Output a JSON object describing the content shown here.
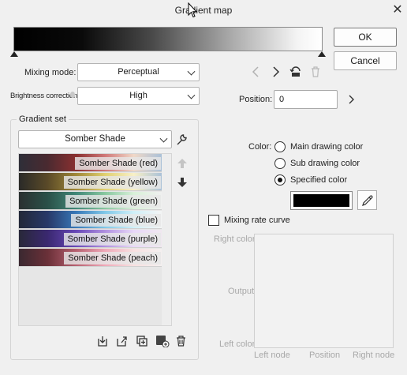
{
  "window": {
    "title": "Gradient map"
  },
  "buttons": {
    "ok": "OK",
    "cancel": "Cancel"
  },
  "mixing_mode": {
    "label": "Mixing mode:",
    "value": "Perceptual"
  },
  "brightness_correction": {
    "label": "Brightness correction",
    "value": "High"
  },
  "gradient_set": {
    "title": "Gradient set",
    "selected": "Somber Shade",
    "items": [
      {
        "label": "Somber Shade (red)",
        "colors": [
          "#2e2e38",
          "#4a2a30",
          "#8a3030",
          "#d07878",
          "#f0d8c8",
          "#a8c0d8"
        ]
      },
      {
        "label": "Somber Shade (yellow)",
        "colors": [
          "#2a2a28",
          "#5a4a28",
          "#a08838",
          "#e0d070",
          "#f8f0c8",
          "#a8c0d8"
        ]
      },
      {
        "label": "Somber Shade (green)",
        "colors": [
          "#2a3030",
          "#2a5048",
          "#408878",
          "#88c8a0",
          "#d8f0d8",
          "#f0f0f0"
        ]
      },
      {
        "label": "Somber Shade (blue)",
        "colors": [
          "#222838",
          "#283868",
          "#3878b8",
          "#80c8e8",
          "#d0f0f8",
          "#f4f4f4"
        ]
      },
      {
        "label": "Somber Shade (purple)",
        "colors": [
          "#282838",
          "#3a2870",
          "#6848b8",
          "#b090e0",
          "#e8d8f8",
          "#f0e8f0"
        ]
      },
      {
        "label": "Somber Shade (peach)",
        "colors": [
          "#3a2830",
          "#6a3038",
          "#b86070",
          "#f0a8b8",
          "#f8e0e0",
          "#f4f0f0"
        ]
      }
    ]
  },
  "position": {
    "label": "Position:",
    "value": "0"
  },
  "color": {
    "label": "Color:",
    "options": [
      "Main drawing color",
      "Sub drawing color",
      "Specified color"
    ],
    "selected": "Specified color",
    "swatch": "#000000"
  },
  "mixing_rate_curve": {
    "label": "Mixing rate curve",
    "right_color": "Right color",
    "output": "Output",
    "left_color": "Left color",
    "left_node": "Left node",
    "position": "Position",
    "right_node": "Right node"
  },
  "icons": [
    "wrench-icon",
    "arrow-up-icon",
    "arrow-down-icon",
    "chevron-left-icon",
    "chevron-right-icon",
    "link-node-icon",
    "trash-icon",
    "eyedropper-icon",
    "import-icon",
    "export-icon",
    "duplicate-icon",
    "add-gradient-icon"
  ]
}
